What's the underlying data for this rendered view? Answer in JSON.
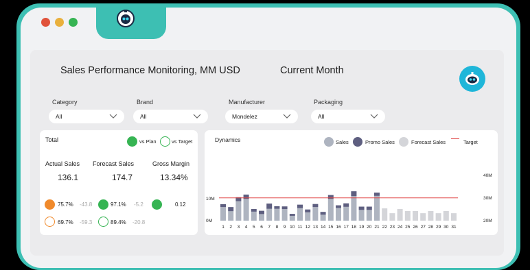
{
  "window": {
    "dots": [
      "#e0523a",
      "#e9b03c",
      "#36b453"
    ],
    "accent": "#3dbfb3"
  },
  "header": {
    "title": "Sales Performance Monitoring, MM USD",
    "period": "Current Month"
  },
  "filters": [
    {
      "label": "Category",
      "value": "All"
    },
    {
      "label": "Brand",
      "value": "All"
    },
    {
      "label": "Manufacturer",
      "value": "Mondelez"
    },
    {
      "label": "Packaging",
      "value": "All"
    }
  ],
  "total": {
    "title": "Total",
    "legend": {
      "vs_plan": "vs Plan",
      "vs_target": "vs Target"
    },
    "metrics": [
      {
        "label": "Actual Sales",
        "value": "136.1"
      },
      {
        "label": "Forecast Sales",
        "value": "174.7"
      },
      {
        "label": "Gross Margin",
        "value": "13.34%"
      }
    ],
    "plan_row": [
      {
        "pct": "75.7%",
        "delta": "-43.8",
        "color": "#f08a2c"
      },
      {
        "pct": "97.1%",
        "delta": "-5.2",
        "color": "#36b453"
      },
      {
        "pct": "",
        "delta": "0.12",
        "color": "#36b453"
      }
    ],
    "target_row": [
      {
        "pct": "69.7%",
        "delta": "-59.3",
        "color": "#f08a2c"
      },
      {
        "pct": "89.4%",
        "delta": "-20.8",
        "color": "#36b453"
      }
    ]
  },
  "chart_data": {
    "type": "bar",
    "title": "Dynamics",
    "legend": [
      "Sales",
      "Promo Sales",
      "Forecast Sales",
      "Target"
    ],
    "colors": {
      "sales": "#aeb4c0",
      "promo": "#5e5f80",
      "forecast": "#d4d5d9",
      "target": "#e04545"
    },
    "categories": [
      "1",
      "2",
      "3",
      "4",
      "5",
      "6",
      "7",
      "8",
      "9",
      "10",
      "11",
      "12",
      "13",
      "14",
      "15",
      "16",
      "17",
      "18",
      "19",
      "20",
      "21",
      "22",
      "23",
      "24",
      "25",
      "26",
      "27",
      "28",
      "29",
      "30",
      "31"
    ],
    "series": [
      {
        "name": "Sales",
        "values": [
          6.2,
          4.3,
          8.9,
          9.9,
          4.1,
          3.0,
          5.4,
          5.4,
          5.3,
          2.2,
          5.7,
          3.8,
          6.2,
          2.7,
          9.9,
          5.8,
          6.3,
          11.2,
          4.9,
          4.9,
          11.3,
          null,
          null,
          null,
          null,
          null,
          null,
          null,
          null,
          null,
          null
        ]
      },
      {
        "name": "Promo Sales",
        "values": [
          1.3,
          1.9,
          1.8,
          2.0,
          1.2,
          1.5,
          2.4,
          1.2,
          1.2,
          0.9,
          1.6,
          1.3,
          1.4,
          1.3,
          1.8,
          1.2,
          1.6,
          2.2,
          1.5,
          1.5,
          1.5,
          null,
          null,
          null,
          null,
          null,
          null,
          null,
          null,
          null,
          null
        ]
      },
      {
        "name": "Forecast Sales",
        "values": [
          null,
          null,
          null,
          null,
          null,
          null,
          null,
          null,
          null,
          null,
          null,
          null,
          null,
          null,
          null,
          null,
          null,
          null,
          null,
          null,
          null,
          5.6,
          3.4,
          5.3,
          4.4,
          4.4,
          3.4,
          4.4,
          3.4,
          4.4,
          3.4
        ]
      }
    ],
    "target": 10.4,
    "left_axis": {
      "ticks": [
        "0M",
        "10M"
      ],
      "values": [
        0,
        10
      ]
    },
    "right_axis": {
      "ticks": [
        "20M",
        "30M",
        "40M"
      ],
      "values": [
        20,
        30,
        40
      ]
    },
    "ylim": [
      0,
      20
    ]
  }
}
